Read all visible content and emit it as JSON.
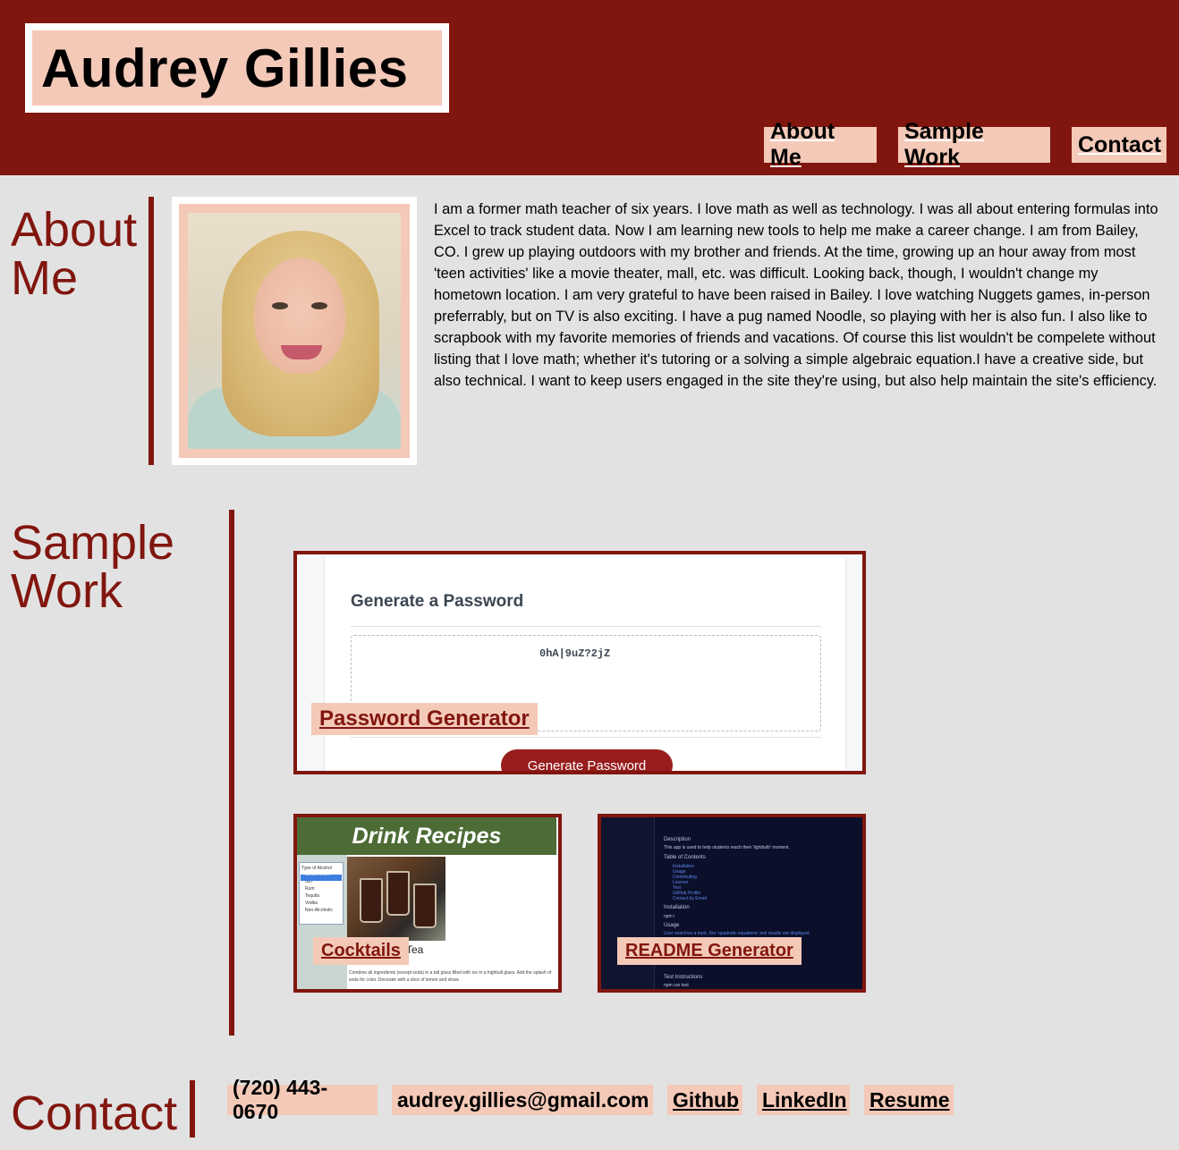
{
  "header": {
    "name": "Audrey Gillies",
    "nav": [
      "About Me",
      "Sample Work",
      "Contact"
    ]
  },
  "about": {
    "title_line1": "About",
    "title_line2": "Me",
    "photo_icon": "portrait-photo",
    "text": "I am a former math teacher of six years. I love math as well as technology. I was all about entering formulas into Excel to track student data. Now I am learning new tools to help me make a career change. I am from Bailey, CO. I grew up playing outdoors with my brother and friends. At the time, growing up an hour away from most 'teen activities' like a movie theater, mall, etc. was difficult. Looking back, though, I wouldn't change my hometown location. I am very grateful to have been raised in Bailey. I love watching Nuggets games, in-person preferrably, but on TV is also exciting. I have a pug named Noodle, so playing with her is also fun. I also like to scrapbook with my favorite memories of friends and vacations. Of course this list wouldn't be compelete without listing that I love math; whether it's tutoring or a solving a simple algebraic equation.I have a creative side, but also technical. I want to keep users engaged in the site they're using, but also help maintain the site's efficiency."
  },
  "work": {
    "title_line1": "Sample",
    "title_line2": "Work",
    "password": {
      "label": "Password Generator",
      "screenshot_title": "Generate a Password",
      "screenshot_password": "0hA|9uZ?2jZ",
      "screenshot_button": "Generate Password"
    },
    "cocktails": {
      "label": "Cocktails",
      "screenshot_banner": "Drink Recipes",
      "screenshot_menu": [
        "Type of Alcohol",
        "Select One...",
        "Gin",
        "Rum",
        "Tequila",
        "Vodka",
        "Non-Alcoholic"
      ],
      "screenshot_caption": "Tea",
      "screenshot_text": "Combine all ingredients (except soda) in a tall glass filled with ice in a highball glass. Add the splash of soda for color. Decorate with a slice of lemon and straw."
    },
    "readme": {
      "label": "README Generator",
      "screenshot_lines": [
        "Description",
        "This app is used to help students reach their 'lightbulb' moment.",
        "Table of Contents",
        "Installation",
        "Usage",
        "Contributing",
        "License",
        "Test",
        "GitHub Profile",
        "Contact by Email",
        "Installation",
        "npm i",
        "Usage",
        "User searches a topic, like 'quadratic equations' and results are displayed",
        "Test Instructions",
        "npm run test"
      ]
    }
  },
  "contact": {
    "title": "Contact",
    "phone": "(720) 443-0670",
    "email": "audrey.gillies@gmail.com",
    "links": [
      "Github",
      "LinkedIn",
      "Resume"
    ]
  },
  "colors": {
    "brand": "#81160f",
    "accent": "#f4c9b8",
    "background": "#e2e2e2"
  }
}
